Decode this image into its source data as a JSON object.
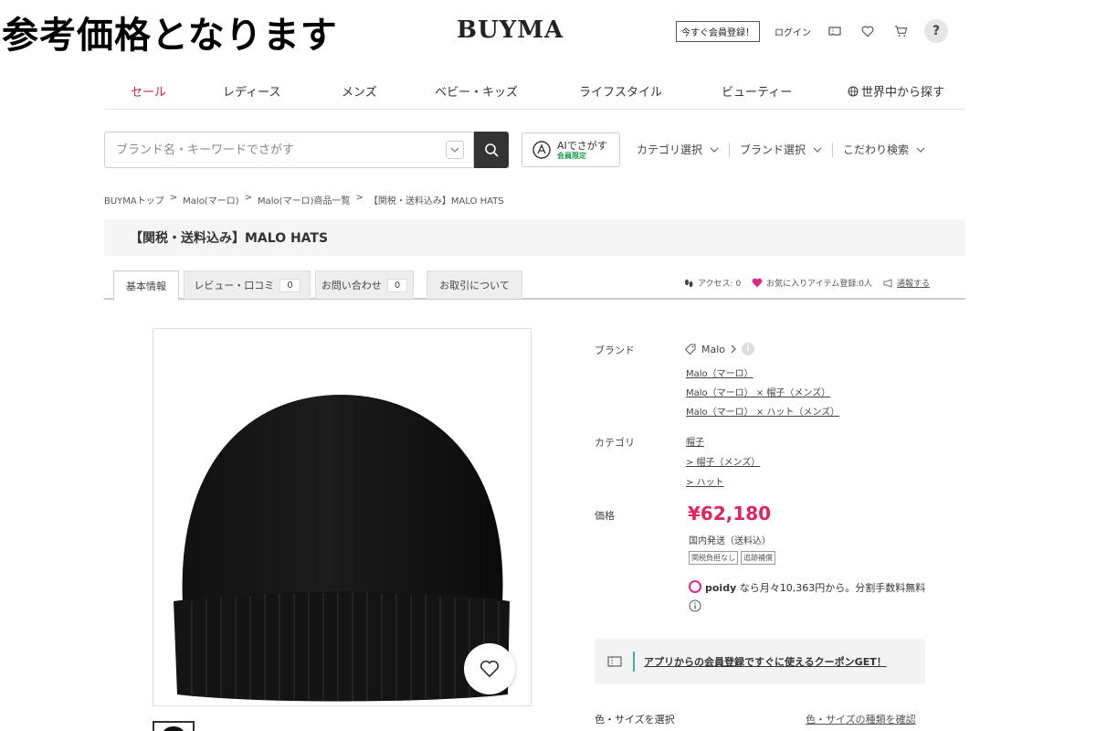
{
  "overlay": {
    "text": "参考価格となります"
  },
  "header": {
    "logo": "BUYMA",
    "register_label": "今すぐ会員登録！",
    "login_label": "ログイン",
    "help_label": "?"
  },
  "nav": {
    "items": [
      "セール",
      "レディース",
      "メンズ",
      "ベビー・キッズ",
      "ライフスタイル",
      "ビューティー",
      "世界中から探す"
    ]
  },
  "search": {
    "placeholder": "ブランド名・キーワードでさがす",
    "ai_label": "AIでさがす",
    "ai_sub": "会員限定",
    "filters": [
      "カテゴリ選択",
      "ブランド選択",
      "こだわり検索"
    ]
  },
  "breadcrumb": [
    "BUYMAトップ",
    ">",
    "Malo(マーロ)",
    ">",
    "Malo(マーロ)商品一覧",
    ">",
    "【関税・送料込み】MALO HATS"
  ],
  "item": {
    "title": "【関税・送料込み】MALO HATS"
  },
  "tabs": [
    {
      "label": "基本情報",
      "count": ""
    },
    {
      "label": "レビュー・口コミ",
      "count": "0"
    },
    {
      "label": "お問い合わせ",
      "count": "0"
    },
    {
      "label": "お取引について",
      "count": ""
    }
  ],
  "stats": {
    "access": "アクセス: 0",
    "favorites": "お気に入りアイテム登録:0人",
    "report": "通報する"
  },
  "details": {
    "brand_label": "ブランド",
    "brand_name": "Malo",
    "brand_links": [
      "Malo（マーロ）",
      "Malo（マーロ） × 帽子（メンズ）",
      "Malo（マーロ） × ハット（メンズ）"
    ],
    "category_label": "カテゴリ",
    "category_links": [
      "帽子",
      "> 帽子（メンズ）",
      "> ハット"
    ],
    "price_label": "価格",
    "price": "¥62,180",
    "shipping": "国内発送（送料込）",
    "badges": [
      "関税負担なし",
      "追跡補償"
    ],
    "poidy_brand": "poidy",
    "poidy_text": "なら月々10,363円から。分割手数料無料",
    "coupon": "アプリからの会員登録ですぐに使えるクーポンGET！",
    "select_label": "色・サイズを選択",
    "select_link": "色・サイズの種類を確認"
  },
  "colors": {
    "sale": "#d0204a",
    "price": "#e0245e",
    "accent_green": "#1a9d4c",
    "poidy_pink": "#d92a8a"
  }
}
